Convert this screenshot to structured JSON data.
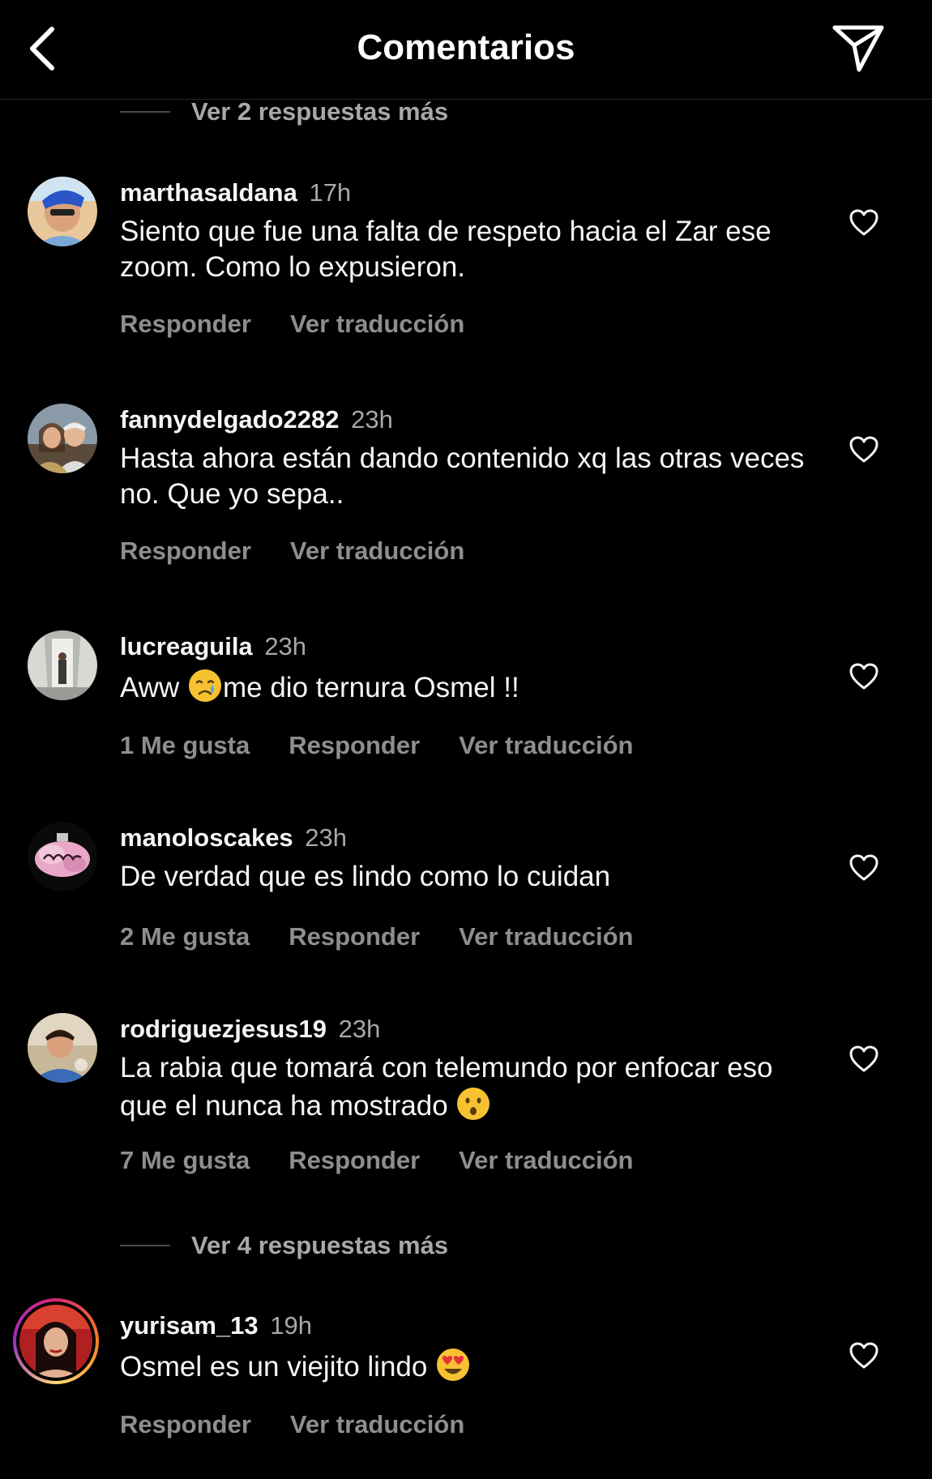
{
  "header": {
    "title": "Comentarios",
    "back_icon": "chevron-left-icon",
    "share_icon": "paper-plane-icon"
  },
  "view_more_top": "Ver 2 respuestas más",
  "view_more_bottom": "Ver 4 respuestas más",
  "labels": {
    "reply": "Responder",
    "translate": "Ver traducción"
  },
  "comments": [
    {
      "username": "marthasaldana",
      "time": "17h",
      "text": "Siento que fue una falta de respeto hacia el Zar ese zoom. Como lo expusieron.",
      "likes": ""
    },
    {
      "username": "fannydelgado2282",
      "time": "23h",
      "text": "Hasta ahora están dando contenido xq las otras veces no. Que yo sepa..",
      "likes": ""
    },
    {
      "username": "lucreaguila",
      "time": "23h",
      "text_before": "Aww ",
      "emoji": "crying-face-emoji",
      "text_after": "me dio ternura Osmel !!",
      "likes": "1 Me gusta"
    },
    {
      "username": "manoloscakes",
      "time": "23h",
      "text": "De verdad que es lindo como lo cuidan",
      "likes": "2 Me gusta"
    },
    {
      "username": "rodriguezjesus19",
      "time": "23h",
      "text": "La rabia que tomará con telemundo por enfocar eso que el nunca ha mostrado ",
      "emoji": "hushed-face-emoji",
      "likes": "7 Me gusta"
    },
    {
      "username": "yurisam_13",
      "time": "19h",
      "text": "Osmel es un viejito lindo ",
      "emoji": "heart-eyes-emoji",
      "likes": ""
    }
  ],
  "colors": {
    "background": "#000000",
    "text": "#f5f5f5",
    "secondary": "#a8a8a8",
    "action": "#8e8e8e"
  }
}
